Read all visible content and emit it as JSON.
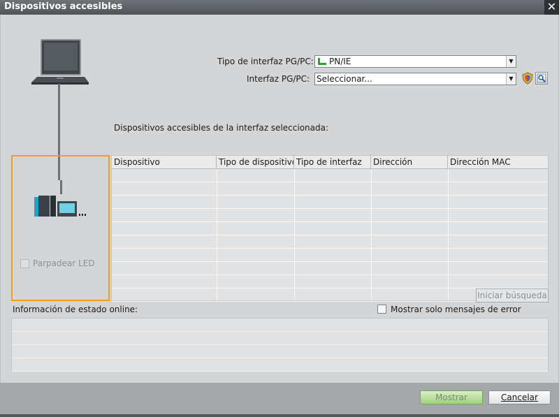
{
  "window": {
    "title": "Dispositivos accesibles",
    "close_glyph": "✕"
  },
  "form": {
    "interface_type_label": "Tipo de interfaz PG/PC:",
    "interface_type_value": "PN/IE",
    "interface_label": "Interfaz PG/PC:",
    "interface_value": "Seleccionar..."
  },
  "devices": {
    "section_title": "Dispositivos accesibles de la interfaz seleccionada:",
    "columns": [
      "Dispositivo",
      "Tipo de dispositivo",
      "Tipo de interfaz",
      "Dirección",
      "Dirección MAC"
    ],
    "row_count": 10,
    "blink_led_label": "Parpadear LED",
    "start_search_label": "Iniciar búsqueda"
  },
  "status": {
    "title": "Información de estado online:",
    "only_errors_label": "Mostrar solo mensajes de error",
    "row_count": 4
  },
  "footer": {
    "show_label": "Mostrar",
    "cancel_label": "Cancelar"
  },
  "colors": {
    "highlight_border": "#f0a11c",
    "show_button": "#9fd07a",
    "network_icon": "#22a531"
  }
}
